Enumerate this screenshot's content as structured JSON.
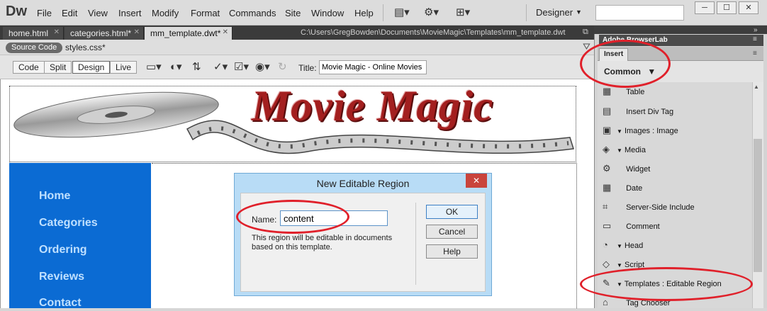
{
  "app": {
    "logo": "Dw",
    "menus": [
      "File",
      "Edit",
      "View",
      "Insert",
      "Modify",
      "Format",
      "Commands",
      "Site",
      "Window",
      "Help"
    ],
    "workspace": "Designer",
    "window_buttons": [
      "─",
      "☐",
      "✕"
    ]
  },
  "doc_tabs": [
    {
      "label": "home.html"
    },
    {
      "label": "categories.html*"
    },
    {
      "label": "mm_template.dwt*"
    }
  ],
  "doc_path": "C:\\Users\\GregBowden\\Documents\\MovieMagic\\Templates\\mm_template.dwt",
  "related": {
    "source_code": "Source Code",
    "file": "styles.css*"
  },
  "view_toolbar": {
    "buttons": [
      "Code",
      "Split",
      "Design",
      "Live"
    ],
    "active": "Design",
    "title_label": "Title:",
    "title_value": "Movie Magic - Online Movies"
  },
  "page": {
    "logo_text": "Movie Magic",
    "nav": [
      "Home",
      "Categories",
      "Ordering",
      "Reviews",
      "Contact"
    ],
    "sidebar_color": "#0b6bd3"
  },
  "dialog": {
    "title": "New Editable Region",
    "name_label": "Name:",
    "name_value": "content",
    "note": "This region will be editable in documents based on this template.",
    "ok": "OK",
    "cancel": "Cancel",
    "help": "Help"
  },
  "panel": {
    "browserlab": "Adobe BrowserLab",
    "insert_tab": "Insert",
    "category": "Common",
    "items": [
      {
        "label": "Table",
        "icon": "table-icon"
      },
      {
        "label": "Insert Div Tag",
        "icon": "div-icon"
      },
      {
        "label": "Images : Image",
        "icon": "image-icon"
      },
      {
        "label": "Media",
        "icon": "media-icon"
      },
      {
        "label": "Widget",
        "icon": "widget-icon"
      },
      {
        "label": "Date",
        "icon": "date-icon"
      },
      {
        "label": "Server-Side Include",
        "icon": "ssi-icon"
      },
      {
        "label": "Comment",
        "icon": "comment-icon"
      },
      {
        "label": "Head",
        "icon": "head-icon"
      },
      {
        "label": "Script",
        "icon": "script-icon"
      },
      {
        "label": "Templates : Editable Region",
        "icon": "editable-region-icon"
      },
      {
        "label": "Tag Chooser",
        "icon": "tag-chooser-icon"
      }
    ]
  },
  "highlight_color": "#e0202a"
}
